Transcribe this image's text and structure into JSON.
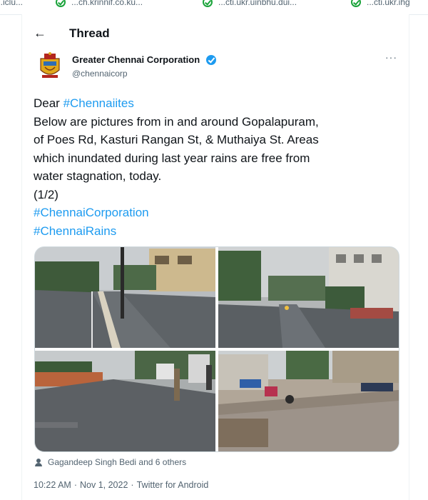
{
  "top_tabs": [
    {
      "label": "...iclu..."
    },
    {
      "label": "...ch.krinnif.co.ku..."
    },
    {
      "label": "...cti.ukr.uinbhu.dui..."
    },
    {
      "label": "...cti.ukr.ihg"
    }
  ],
  "header": {
    "title": "Thread",
    "back_icon": "arrow-left-icon"
  },
  "tweet": {
    "author": "Greater Chennai Corporation",
    "handle": "@chennaicorp",
    "verified": true,
    "more_label": "···",
    "lines": {
      "l1_prefix": "Dear ",
      "l1_tag": "#Chennaiites",
      "l2": "Below are pictures from in and around Gopalapuram,",
      "l3": "of Poes Rd, Kasturi Rangan St, & Muthaiya St. Areas",
      "l4": "which inundated during last year rains are free from",
      "l5": "water stagnation, today.",
      "l6": "(1/2)",
      "tag1": "#ChennaiCorporation",
      "tag2": "#ChennaiRains"
    },
    "photos": [
      {
        "alt": "Wet road with median and trees"
      },
      {
        "alt": "Rain-soaked street with buildings"
      },
      {
        "alt": "Wet street with parked cars and pedestrians"
      },
      {
        "alt": "Street with parked two-wheelers"
      }
    ],
    "liked_by": "Gagandeep Singh Bedi and 6 others",
    "time": "10:22 AM",
    "date": "Nov 1, 2022",
    "source": "Twitter for Android",
    "sep": "·"
  },
  "colors": {
    "link": "#1d9bf0",
    "muted": "#536471",
    "text": "#0f1419"
  }
}
